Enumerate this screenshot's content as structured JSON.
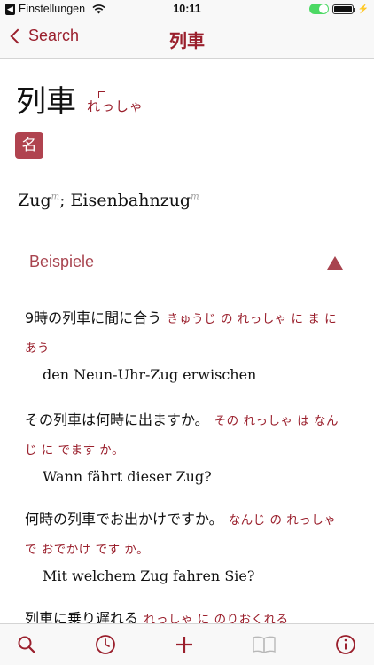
{
  "status_bar": {
    "back_app": "Einstellungen",
    "time": "10:11"
  },
  "nav": {
    "back_label": "Search",
    "title": "列車"
  },
  "entry": {
    "headword": "列車",
    "reading": "れっしゃ",
    "pos_badge": "名",
    "definition": {
      "word1": "Zug",
      "gender1": "m",
      "separator": "; ",
      "word2": "Eisenbahnzug",
      "gender2": "m"
    }
  },
  "examples": {
    "label": "Beispiele",
    "items": [
      {
        "jp": "9時の列車に間に合う",
        "kana": "きゅうじ の れっしゃ に ま に あう",
        "de": "den Neun-Uhr-Zug erwischen"
      },
      {
        "jp": "その列車は何時に出ますか。",
        "kana": "その れっしゃ は なんじ に でます か。",
        "de": "Wann fährt dieser Zug?"
      },
      {
        "jp": "何時の列車でお出かけですか。",
        "kana": "なんじ の れっしゃ で おでかけ です か。",
        "de": "Mit welchem Zug fahren Sie?"
      },
      {
        "jp": "列車に乗り遅れる",
        "kana": "れっしゃ に のりおくれる",
        "de": ""
      }
    ]
  },
  "colors": {
    "accent": "#9a1f2c",
    "badge": "#b0434f",
    "section": "#a8444f"
  },
  "tab_bar": {
    "items": [
      "search-icon",
      "clock-icon",
      "plus-icon",
      "book-icon",
      "info-icon"
    ]
  }
}
